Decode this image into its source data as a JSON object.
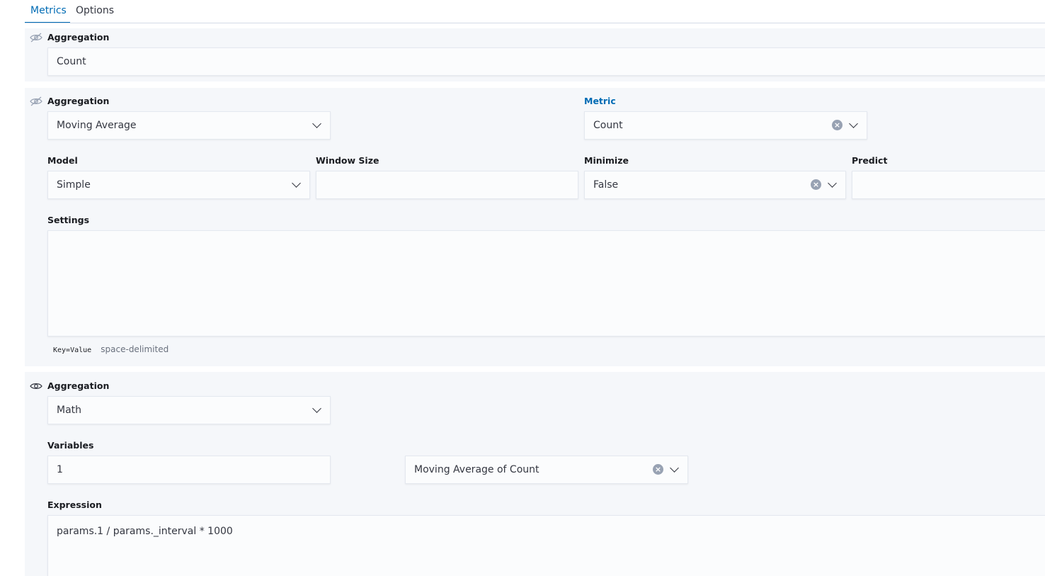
{
  "tabs": [
    {
      "label": "Metrics",
      "active": true
    },
    {
      "label": "Options",
      "active": false
    }
  ],
  "blocks": [
    {
      "visibility_icon": "eye-closed-icon",
      "aggregation_label": "Aggregation",
      "aggregation_value": "Count"
    },
    {
      "visibility_icon": "eye-closed-icon",
      "aggregation_label": "Aggregation",
      "aggregation_value": "Moving Average",
      "metric_label": "Metric",
      "metric_value": "Count",
      "model_label": "Model",
      "model_value": "Simple",
      "window_size_label": "Window Size",
      "window_size_value": "",
      "minimize_label": "Minimize",
      "minimize_value": "False",
      "predict_label": "Predict",
      "predict_value": "",
      "settings_label": "Settings",
      "settings_value": "",
      "settings_help_code": "Key=Value",
      "settings_help_text": "space-delimited"
    },
    {
      "visibility_icon": "eye-icon",
      "aggregation_label": "Aggregation",
      "aggregation_value": "Math",
      "variables_label": "Variables",
      "variable_name": "1",
      "variable_metric": "Moving Average of Count",
      "expression_label": "Expression",
      "expression_value": "params.1 / params._interval * 1000"
    }
  ],
  "colors": {
    "accent": "#006bb4",
    "panel_bg": "#f5f7fa",
    "field_bg": "#fbfcfd"
  }
}
